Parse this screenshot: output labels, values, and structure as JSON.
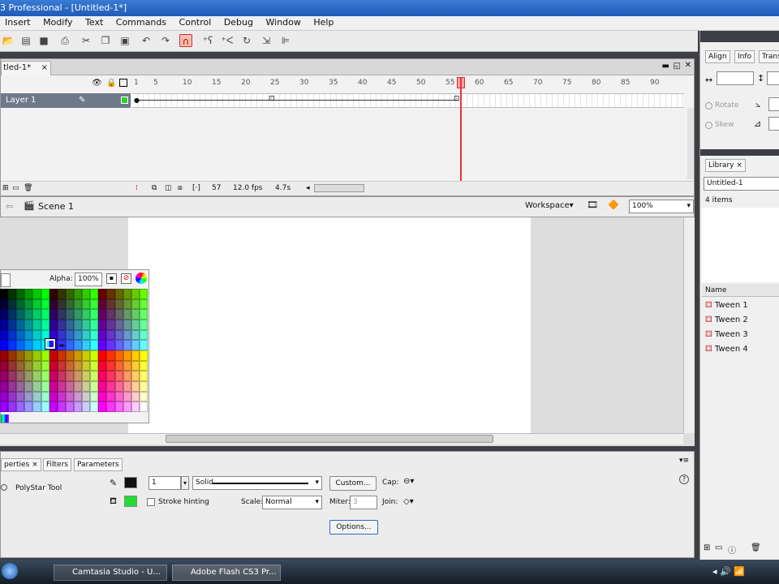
{
  "window": {
    "title": "3 Professional - [Untitled-1*]"
  },
  "menu": [
    "Insert",
    "Modify",
    "Text",
    "Commands",
    "Control",
    "Debug",
    "Window",
    "Help"
  ],
  "document_tab": "tled-1*",
  "timeline": {
    "layer_name": "Layer 1",
    "ruler_ticks": [
      "1",
      "5",
      "10",
      "15",
      "20",
      "25",
      "30",
      "35",
      "40",
      "45",
      "50",
      "55",
      "60",
      "65",
      "70",
      "75",
      "80",
      "85",
      "90"
    ],
    "current_frame": "57",
    "frame_rate": "12.0 fps",
    "elapsed_time": "4.7s"
  },
  "edit_bar": {
    "scene": "Scene 1",
    "workspace_label": "Workspace",
    "zoom": "100%"
  },
  "swatches": {
    "alpha_label": "Alpha:",
    "alpha_value": "100%"
  },
  "properties": {
    "tabs": [
      "perties",
      "Filters",
      "Parameters"
    ],
    "tool_name": "PolyStar Tool",
    "stroke_width": "1",
    "stroke_style": "Solid",
    "custom_button": "Custom...",
    "cap_label": "Cap:",
    "stroke_hinting": "Stroke hinting",
    "scale_label": "Scale:",
    "scale_value": "Normal",
    "miter_label": "Miter:",
    "miter_value": "3",
    "join_label": "Join:",
    "options_button": "Options...",
    "stroke_color": "#111111",
    "fill_color": "#22dd33"
  },
  "right_panel": {
    "tabs": [
      "Align",
      "Info",
      "Trans"
    ],
    "rotate_label": "Rotate",
    "skew_label": "Skew",
    "library_tab": "Library",
    "library_doc": "Untitled-1",
    "items_count": "4 items",
    "name_header": "Name",
    "items": [
      "Tween 1",
      "Tween 2",
      "Tween 3",
      "Tween 4"
    ]
  },
  "taskbar": {
    "apps": [
      "Camtasia Studio - U...",
      "Adobe Flash CS3 Pr..."
    ]
  }
}
